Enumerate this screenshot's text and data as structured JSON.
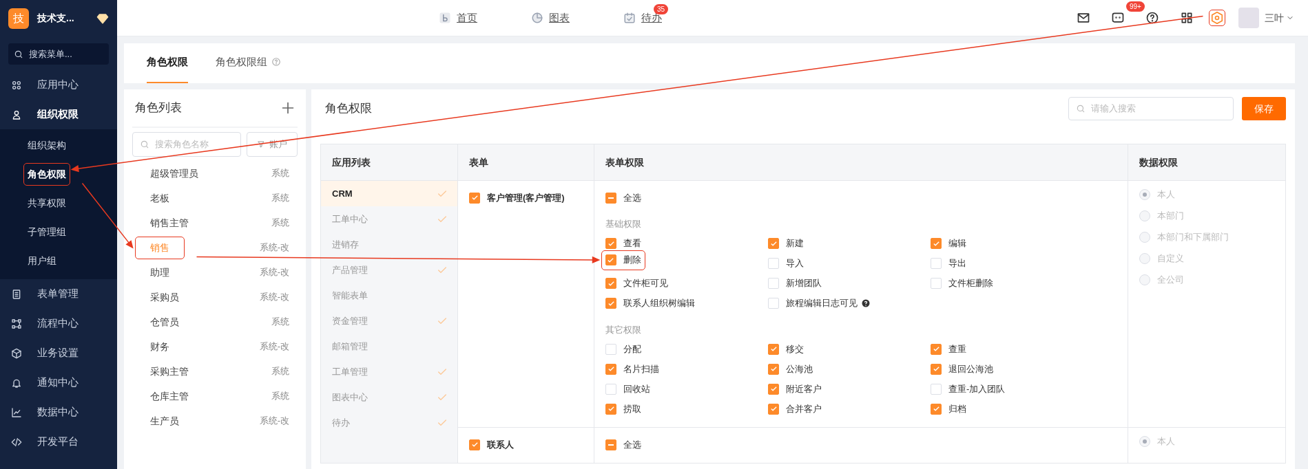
{
  "sidebar": {
    "brand": {
      "initial": "技",
      "name": "技术支..."
    },
    "search": {
      "placeholder": "搜索菜单..."
    },
    "items": [
      {
        "label": "应用中心",
        "expanded": false
      },
      {
        "label": "组织权限",
        "expanded": true,
        "children": [
          {
            "label": "组织架构",
            "selected": false,
            "highlighted": false
          },
          {
            "label": "角色权限",
            "selected": true,
            "highlighted": true
          },
          {
            "label": "共享权限",
            "selected": false,
            "highlighted": false
          },
          {
            "label": "子管理组",
            "selected": false,
            "highlighted": false
          },
          {
            "label": "用户组",
            "selected": false,
            "highlighted": false
          }
        ]
      },
      {
        "label": "表单管理",
        "expanded": false
      },
      {
        "label": "流程中心",
        "expanded": false
      },
      {
        "label": "业务设置",
        "expanded": false
      },
      {
        "label": "通知中心",
        "expanded": false
      },
      {
        "label": "数据中心",
        "expanded": false
      },
      {
        "label": "开发平台",
        "expanded": false
      }
    ]
  },
  "header": {
    "nav": [
      {
        "label": "首页"
      },
      {
        "label": "图表"
      },
      {
        "label": "待办",
        "badge": "35"
      }
    ],
    "chat_badge": "99+",
    "settings_highlighted": true,
    "user": "三叶"
  },
  "tabs": [
    {
      "label": "角色权限",
      "selected": true,
      "help": false
    },
    {
      "label": "角色权限组",
      "selected": false,
      "help": true
    }
  ],
  "roles": {
    "title": "角色列表",
    "search_placeholder": "搜索角色名称",
    "filter": "账户",
    "items": [
      {
        "name": "超级管理员",
        "tag": "系统",
        "selected": false,
        "highlighted": false
      },
      {
        "name": "老板",
        "tag": "系统",
        "selected": false,
        "highlighted": false
      },
      {
        "name": "销售主管",
        "tag": "系统",
        "selected": false,
        "highlighted": false
      },
      {
        "name": "销售",
        "tag": "系统-改",
        "selected": true,
        "highlighted": true
      },
      {
        "name": "助理",
        "tag": "系统-改",
        "selected": false,
        "highlighted": false
      },
      {
        "name": "采购员",
        "tag": "系统-改",
        "selected": false,
        "highlighted": false
      },
      {
        "name": "仓管员",
        "tag": "系统",
        "selected": false,
        "highlighted": false
      },
      {
        "name": "财务",
        "tag": "系统-改",
        "selected": false,
        "highlighted": false
      },
      {
        "name": "采购主管",
        "tag": "系统",
        "selected": false,
        "highlighted": false
      },
      {
        "name": "仓库主管",
        "tag": "系统",
        "selected": false,
        "highlighted": false
      },
      {
        "name": "生产员",
        "tag": "系统-改",
        "selected": false,
        "highlighted": false
      }
    ]
  },
  "permissions": {
    "title": "角色权限",
    "search_placeholder": "请输入搜索",
    "save": "保存",
    "columns": [
      "应用列表",
      "表单",
      "表单权限",
      "数据权限"
    ],
    "apps": [
      {
        "label": "CRM",
        "selected": true,
        "configured": true
      },
      {
        "label": "工单中心",
        "selected": false,
        "configured": true
      },
      {
        "label": "进销存",
        "selected": false,
        "configured": false
      },
      {
        "label": "产品管理",
        "selected": false,
        "configured": true
      },
      {
        "label": "智能表单",
        "selected": false,
        "configured": false
      },
      {
        "label": "资金管理",
        "selected": false,
        "configured": true
      },
      {
        "label": "邮箱管理",
        "selected": false,
        "configured": false
      },
      {
        "label": "工单管理",
        "selected": false,
        "configured": true
      },
      {
        "label": "图表中心",
        "selected": false,
        "configured": true
      },
      {
        "label": "待办",
        "selected": false,
        "configured": true
      }
    ],
    "forms": [
      {
        "label": "客户管理(客户管理)",
        "checked": true,
        "select_all": {
          "label": "全选",
          "indeterminate": true
        },
        "groups": [
          {
            "title": "基础权限",
            "items": [
              {
                "label": "查看",
                "checked": true,
                "help": false,
                "highlighted": false
              },
              {
                "label": "新建",
                "checked": true,
                "help": false,
                "highlighted": false
              },
              {
                "label": "编辑",
                "checked": true,
                "help": false,
                "highlighted": false
              },
              {
                "label": "删除",
                "checked": true,
                "help": false,
                "highlighted": true
              },
              {
                "label": "导入",
                "checked": false,
                "help": false,
                "highlighted": false
              },
              {
                "label": "导出",
                "checked": false,
                "help": false,
                "highlighted": false
              },
              {
                "label": "文件柜可见",
                "checked": true,
                "help": false,
                "highlighted": false
              },
              {
                "label": "新增团队",
                "checked": false,
                "help": false,
                "highlighted": false
              },
              {
                "label": "文件柜删除",
                "checked": false,
                "help": false,
                "highlighted": false
              },
              {
                "label": "联系人组织树编辑",
                "checked": true,
                "help": false,
                "highlighted": false
              },
              {
                "label": "旅程编辑日志可见",
                "checked": false,
                "help": true,
                "highlighted": false
              }
            ]
          },
          {
            "title": "其它权限",
            "items": [
              {
                "label": "分配",
                "checked": false,
                "help": false,
                "highlighted": false
              },
              {
                "label": "移交",
                "checked": true,
                "help": false,
                "highlighted": false
              },
              {
                "label": "查重",
                "checked": true,
                "help": false,
                "highlighted": false
              },
              {
                "label": "名片扫描",
                "checked": true,
                "help": false,
                "highlighted": false
              },
              {
                "label": "公海池",
                "checked": true,
                "help": false,
                "highlighted": false
              },
              {
                "label": "退回公海池",
                "checked": true,
                "help": false,
                "highlighted": false
              },
              {
                "label": "回收站",
                "checked": false,
                "help": false,
                "highlighted": false
              },
              {
                "label": "附近客户",
                "checked": true,
                "help": false,
                "highlighted": false
              },
              {
                "label": "查重-加入团队",
                "checked": false,
                "help": false,
                "highlighted": false
              },
              {
                "label": "捞取",
                "checked": true,
                "help": false,
                "highlighted": false
              },
              {
                "label": "合并客户",
                "checked": true,
                "help": false,
                "highlighted": false
              },
              {
                "label": "归档",
                "checked": true,
                "help": false,
                "highlighted": false
              }
            ]
          }
        ],
        "data_scope": {
          "disabled": true,
          "options": [
            {
              "label": "本人",
              "selected": true
            },
            {
              "label": "本部门",
              "selected": false
            },
            {
              "label": "本部门和下属部门",
              "selected": false
            },
            {
              "label": "自定义",
              "selected": false
            },
            {
              "label": "全公司",
              "selected": false
            }
          ]
        }
      },
      {
        "label": "联系人",
        "checked": true,
        "select_all": {
          "label": "全选",
          "indeterminate": true
        },
        "data_scope": {
          "disabled": true,
          "options": [
            {
              "label": "本人",
              "selected": true
            }
          ]
        }
      }
    ]
  }
}
